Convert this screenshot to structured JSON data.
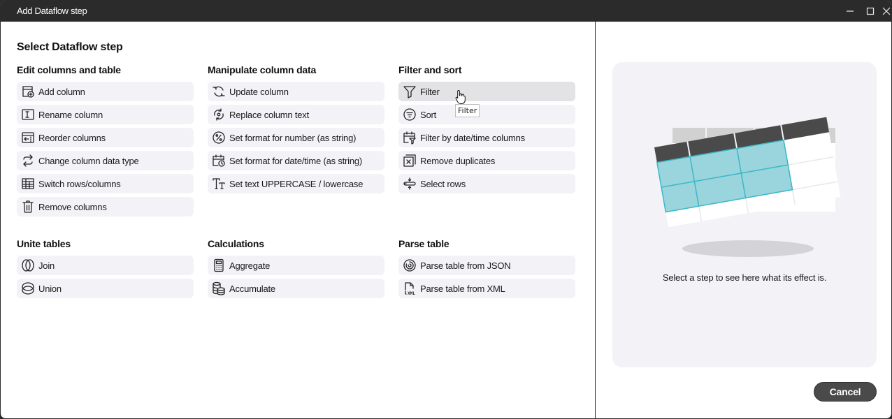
{
  "window": {
    "title": "Add Dataflow step",
    "controls": {
      "minimize": "minimize-icon",
      "maximize": "maximize-icon",
      "close": "close-icon"
    }
  },
  "main": {
    "heading": "Select Dataflow step",
    "groups": [
      {
        "title": "Edit columns and table",
        "items": [
          {
            "label": "Add column",
            "icon": "add-column-icon"
          },
          {
            "label": "Rename column",
            "icon": "rename-icon"
          },
          {
            "label": "Reorder columns",
            "icon": "reorder-icon"
          },
          {
            "label": "Change column data type",
            "icon": "swap-icon"
          },
          {
            "label": "Switch rows/columns",
            "icon": "grid-icon"
          },
          {
            "label": "Remove columns",
            "icon": "trash-icon"
          }
        ]
      },
      {
        "title": "Manipulate column data",
        "items": [
          {
            "label": "Update column",
            "icon": "refresh-icon"
          },
          {
            "label": "Replace column text",
            "icon": "replace-icon"
          },
          {
            "label": "Set format for number (as string)",
            "icon": "percent-icon"
          },
          {
            "label": "Set format for date/time (as string)",
            "icon": "calendar-clock-icon"
          },
          {
            "label": "Set text UPPERCASE / lowercase",
            "icon": "text-case-icon"
          }
        ]
      },
      {
        "title": "Filter and sort",
        "items": [
          {
            "label": "Filter",
            "icon": "filter-icon"
          },
          {
            "label": "Sort",
            "icon": "sort-icon"
          },
          {
            "label": "Filter by date/time columns",
            "icon": "calendar-filter-icon"
          },
          {
            "label": "Remove duplicates",
            "icon": "remove-duplicates-icon"
          },
          {
            "label": "Select rows",
            "icon": "select-rows-icon"
          }
        ]
      },
      {
        "title": "Unite tables",
        "items": [
          {
            "label": "Join",
            "icon": "join-icon"
          },
          {
            "label": "Union",
            "icon": "union-icon"
          }
        ]
      },
      {
        "title": "Calculations",
        "items": [
          {
            "label": "Aggregate",
            "icon": "calculator-icon"
          },
          {
            "label": "Accumulate",
            "icon": "coins-icon"
          }
        ]
      },
      {
        "title": "Parse table",
        "items": [
          {
            "label": "Parse table from JSON",
            "icon": "json-icon"
          },
          {
            "label": "Parse table from XML",
            "icon": "xml-file-icon"
          }
        ]
      }
    ],
    "hovered_item": "Filter",
    "tooltip": "Filter"
  },
  "preview": {
    "text": "Select a step to see here what its effect is.",
    "colors": {
      "highlight": "#9ad4dc",
      "highlight_border": "#3ab8c8",
      "header": "#4a4a4a"
    }
  },
  "footer": {
    "cancel_label": "Cancel"
  }
}
